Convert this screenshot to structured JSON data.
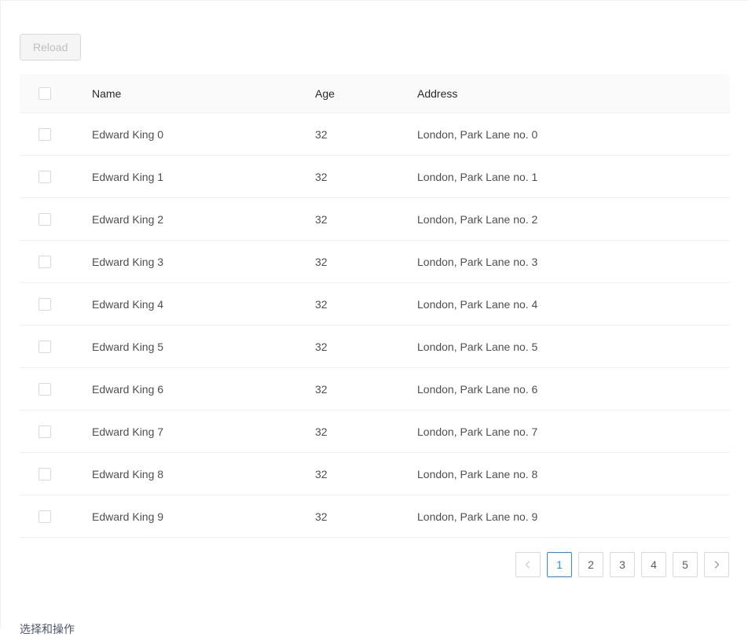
{
  "toolbar": {
    "reload_label": "Reload",
    "reload_disabled": true
  },
  "table": {
    "select_all_checkbox": "select-all",
    "columns": [
      {
        "key": "check",
        "label": ""
      },
      {
        "key": "name",
        "label": "Name"
      },
      {
        "key": "age",
        "label": "Age"
      },
      {
        "key": "address",
        "label": "Address"
      }
    ],
    "rows": [
      {
        "name": "Edward King 0",
        "age": "32",
        "address": "London, Park Lane no. 0"
      },
      {
        "name": "Edward King 1",
        "age": "32",
        "address": "London, Park Lane no. 1"
      },
      {
        "name": "Edward King 2",
        "age": "32",
        "address": "London, Park Lane no. 2"
      },
      {
        "name": "Edward King 3",
        "age": "32",
        "address": "London, Park Lane no. 3"
      },
      {
        "name": "Edward King 4",
        "age": "32",
        "address": "London, Park Lane no. 4"
      },
      {
        "name": "Edward King 5",
        "age": "32",
        "address": "London, Park Lane no. 5"
      },
      {
        "name": "Edward King 6",
        "age": "32",
        "address": "London, Park Lane no. 6"
      },
      {
        "name": "Edward King 7",
        "age": "32",
        "address": "London, Park Lane no. 7"
      },
      {
        "name": "Edward King 8",
        "age": "32",
        "address": "London, Park Lane no. 8"
      },
      {
        "name": "Edward King 9",
        "age": "32",
        "address": "London, Park Lane no. 9"
      }
    ]
  },
  "pagination": {
    "prev_label": "‹",
    "next_label": "›",
    "prev_disabled": true,
    "pages": [
      "1",
      "2",
      "3",
      "4",
      "5"
    ],
    "current_page": "1"
  },
  "footer": {
    "caption": "选择和操作"
  },
  "colors": {
    "accent": "#1890ff",
    "header_bg": "#fafafa",
    "border": "#f0f0f0",
    "control_border": "#d9d9d9",
    "disabled_text": "#bfbfbf",
    "body_text": "rgba(0,0,0,0.7)"
  }
}
